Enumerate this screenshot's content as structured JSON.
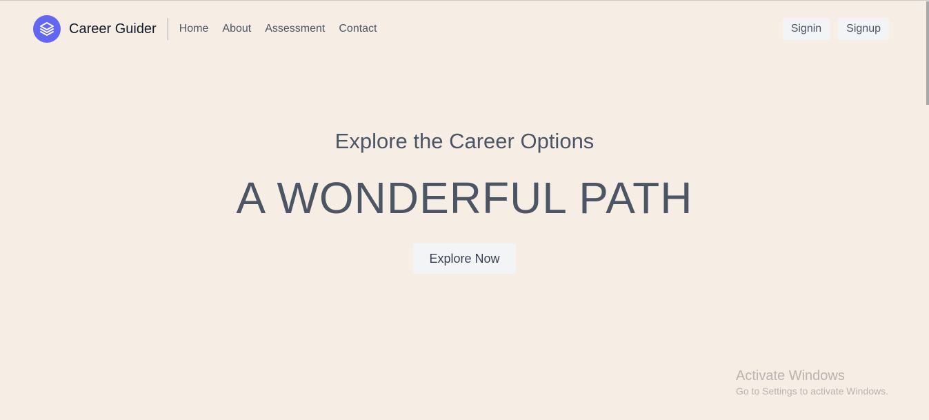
{
  "header": {
    "brand_name": "Career Guider",
    "brand_icon": "layers-icon",
    "nav": [
      {
        "label": "Home"
      },
      {
        "label": "About"
      },
      {
        "label": "Assessment"
      },
      {
        "label": "Contact"
      }
    ],
    "signin_label": "Signin",
    "signup_label": "Signup"
  },
  "hero": {
    "subtitle": "Explore the Career Options",
    "title": "A WONDERFUL PATH",
    "cta_label": "Explore Now"
  },
  "watermark": {
    "title": "Activate Windows",
    "subtitle": "Go to Settings to activate Windows."
  },
  "colors": {
    "background": "#f6ede5",
    "accent": "#6366f1",
    "button_bg": "#f3f4f6",
    "text": "#4b5563"
  }
}
